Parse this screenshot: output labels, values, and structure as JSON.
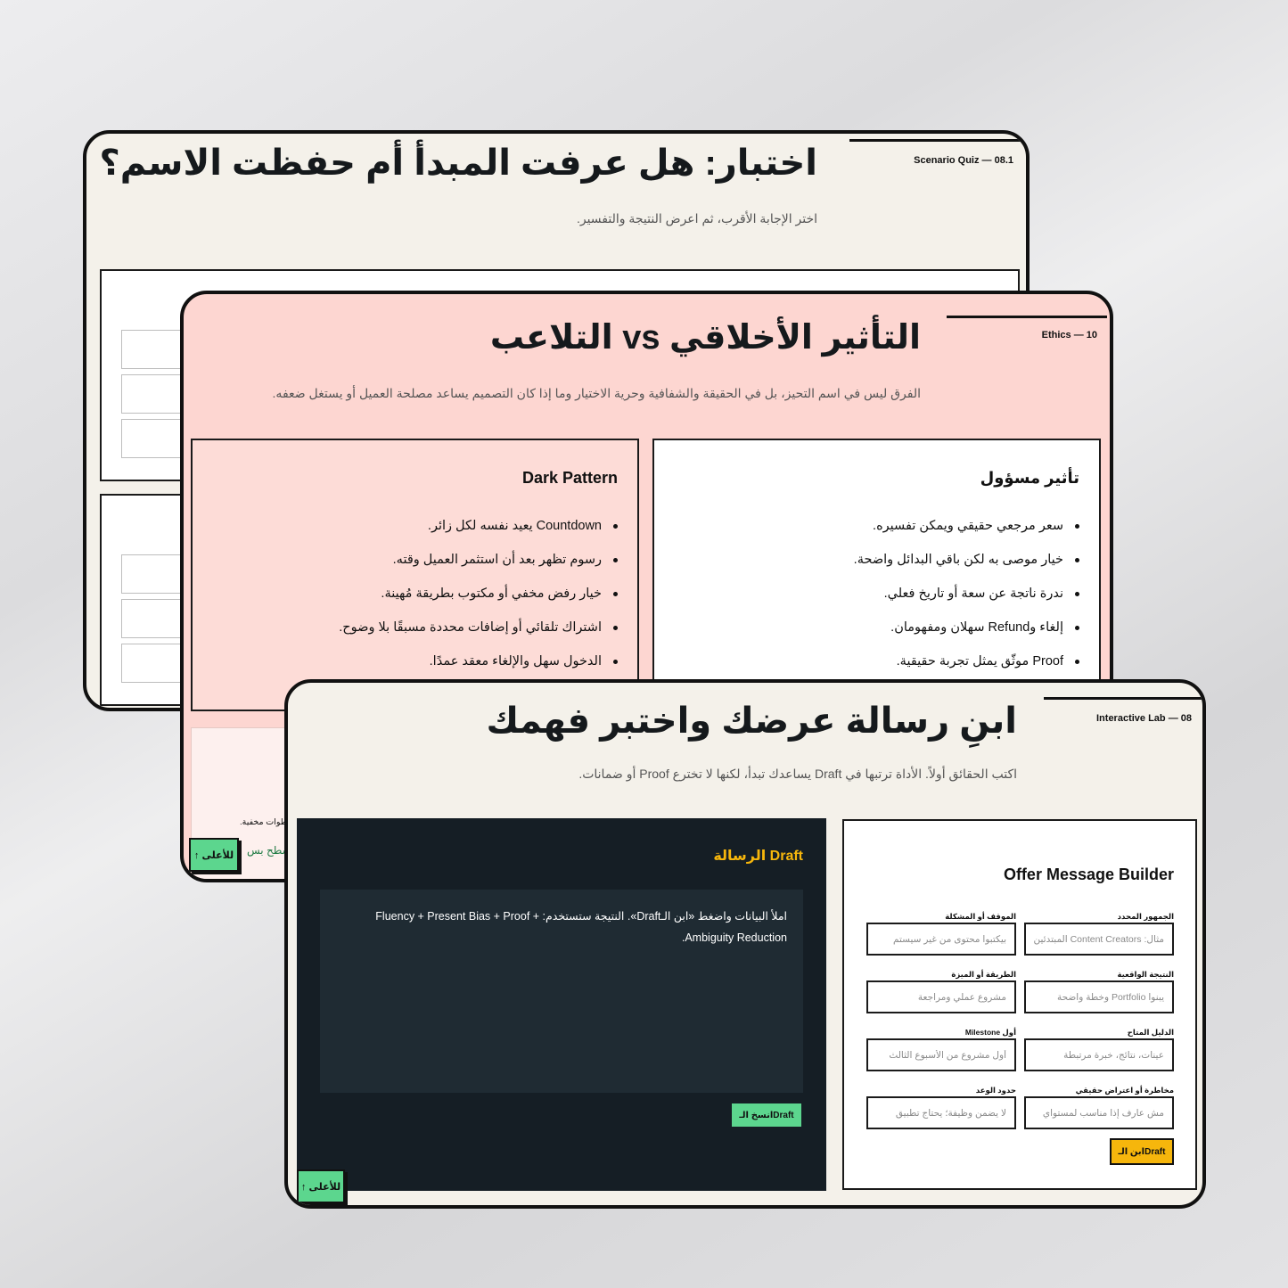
{
  "quiz": {
    "tag": "Scenario Quiz — 08.1",
    "title": "اختبار: هل عرفت المبدأ أم حفظت الاسم؟",
    "subtitle": "اختر الإجابة الأقرب، ثم اعرض النتيجة والتفسير."
  },
  "ethics": {
    "tag": "Ethics — 10",
    "title": "التأثير الأخلاقي vs التلاعب",
    "subtitle": "الفرق ليس في اسم التحيز، بل في الحقيقة والشفافية وحرية الاختيار وما إذا كان التصميم يساعد مصلحة العميل أو يستغل ضعفه.",
    "responsible": {
      "title": "تأثير مسؤول",
      "items": [
        "سعر مرجعي حقيقي ويمكن تفسيره.",
        "خيار موصى به لكن باقي البدائل واضحة.",
        "ندرة ناتجة عن سعة أو تاريخ فعلي.",
        "إلغاء وRefund سهلان ومفهومان.",
        "Proof موثّق يمثل تجربة حقيقية."
      ]
    },
    "dark": {
      "title": "Dark Pattern",
      "items": [
        "Countdown يعيد نفسه لكل زائر.",
        "رسوم تظهر بعد أن استثمر العميل وقته.",
        "خيار رفض مخفي أو مكتوب بطريقة مُهينة.",
        "اشتراك تلقائي أو إضافات محددة مسبقًا بلا وضوح.",
        "الدخول سهل والإلغاء معقد عمدًا."
      ]
    },
    "partial_text_1": "خطوات مخفية.",
    "partial_text_2": "السطح بس",
    "up_button": "↑ للأعلى"
  },
  "lab": {
    "tag": "Interactive Lab — 08",
    "title": "ابنِ رسالة عرضك واختبر فهمك",
    "subtitle": "اكتب الحقائق أولاً. الأداة ترتبها في Draft يساعدك تبدأ، لكنها لا تخترع Proof أو ضمانات.",
    "draft": {
      "title": "Draft الرسالة",
      "body": "املأ البيانات واضغط «ابن الـDraft». النتيجة ستستخدم: Fluency + Present Bias + Proof + Ambiguity Reduction.",
      "copy_button": "انسخ الـDraft"
    },
    "up_button": "↑ للأعلى",
    "builder": {
      "title": "Offer Message Builder",
      "fields": [
        {
          "label": "الجمهور المحدد",
          "placeholder": "مثال: Content Creators المبتدئين"
        },
        {
          "label": "الموقف أو المشكلة",
          "placeholder": "بيكتبوا محتوى من غير سيستم"
        },
        {
          "label": "النتيجة الواقعية",
          "placeholder": "يبنوا Portfolio وخطة واضحة"
        },
        {
          "label": "الطريقة أو الميزة",
          "placeholder": "مشروع عملي ومراجعة"
        },
        {
          "label": "الدليل المتاح",
          "placeholder": "عينات، نتائج، خبرة مرتبطة"
        },
        {
          "label": "أول Milestone",
          "placeholder": "أول مشروع من الأسبوع الثالث"
        },
        {
          "label": "مخاطرة أو اعتراض حقيقي",
          "placeholder": "مش عارف إذا مناسب لمستواي"
        },
        {
          "label": "حدود الوعد",
          "placeholder": "لا يضمن وظيفة؛ يحتاج تطبيق"
        }
      ],
      "build_button": "ابن الـDraft"
    }
  },
  "colors": {
    "quiz_bg": "#f4f1ea",
    "ethics_bg": "#fdd6d1",
    "lab_bg": "#f4f1ea",
    "dark_panel": "#151e25",
    "accent_yellow": "#f6b60c",
    "accent_green": "#5cd68e"
  }
}
